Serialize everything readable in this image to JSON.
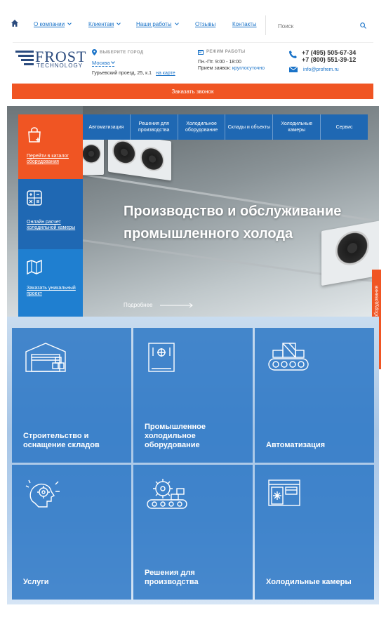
{
  "nav": {
    "items": [
      {
        "label": "О компании",
        "has_dropdown": true
      },
      {
        "label": "Клиентам",
        "has_dropdown": true
      },
      {
        "label": "Наши работы",
        "has_dropdown": true
      },
      {
        "label": "Отзывы",
        "has_dropdown": false
      },
      {
        "label": "Контакты",
        "has_dropdown": false
      }
    ],
    "search_placeholder": "Поиск"
  },
  "header": {
    "logo_text": "FROST",
    "logo_sub": "TECHNOLOGY",
    "city_label": "ВЫБЕРИТЕ ГОРОД",
    "city": "Москва",
    "address": "Гурьевский проезд, 25, к.1",
    "map_link": "на карте",
    "hours_label": "РЕЖИМ РАБОТЫ",
    "hours": "Пн.-Пт. 9:00 - 18:00",
    "orders_prefix": "Прием заявок:",
    "orders_value": "круглосуточно",
    "phone1": "+7 (495) 505-67-34",
    "phone2": "+7 (800) 551-39-12",
    "email": "info@profrem.ru",
    "callback_label": "Заказать звонок"
  },
  "hero": {
    "side_links": [
      "Перейти в каталог оборудования",
      "Онлайн расчет холодильной камеры",
      "Заказать уникальный проект"
    ],
    "categories": [
      "Автоматизация",
      "Решения для производства",
      "Холодильное оборудование",
      "Склады и объекты",
      "Холодильные камеры",
      "Сервис"
    ],
    "title": "Производство и обслуживание промышленного холода",
    "more_label": "Подробнее",
    "side_tab": "Онлайн расчет оборудования"
  },
  "tiles": [
    {
      "label": "Строительство и оснащение складов",
      "icon": "warehouse-icon"
    },
    {
      "label": "Промышленное холодильное оборудование",
      "icon": "fridge-icon"
    },
    {
      "label": "Автоматизация",
      "icon": "conveyor-icon"
    },
    {
      "label": "Услуги",
      "icon": "gear-head-icon"
    },
    {
      "label": "Решения для производства",
      "icon": "production-icon"
    },
    {
      "label": "Холодильные камеры",
      "icon": "cold-room-icon"
    }
  ],
  "colors": {
    "accent": "#f05523",
    "primary": "#1f68b3",
    "link": "#1a73c8"
  }
}
